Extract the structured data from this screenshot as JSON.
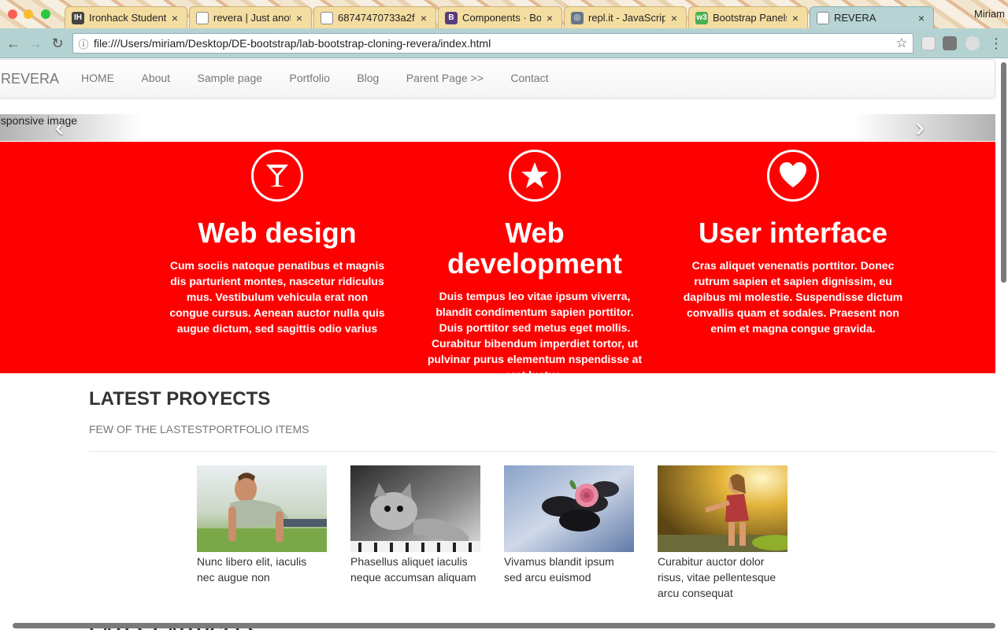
{
  "browser": {
    "tabs": [
      {
        "title": "Ironhack Student |",
        "icon": "ironhack-icon",
        "icon_label": "IH",
        "icon_color": "#444444"
      },
      {
        "title": "revera | Just anoth",
        "icon": "page-icon",
        "icon_label": "",
        "icon_color": "#888888"
      },
      {
        "title": "68747470733a2f",
        "icon": "page-icon",
        "icon_label": "",
        "icon_color": "#888888"
      },
      {
        "title": "Components · Boo",
        "icon": "bootstrap-icon",
        "icon_label": "B",
        "icon_color": "#563d7c"
      },
      {
        "title": "repl.it - JavaScrip",
        "icon": "replit-icon",
        "icon_label": "◎",
        "icon_color": "#667788"
      },
      {
        "title": "Bootstrap Panels",
        "icon": "w3schools-icon",
        "icon_label": "w3",
        "icon_color": "#4caf50"
      },
      {
        "title": "REVERA",
        "icon": "page-icon",
        "icon_label": "",
        "icon_color": "#888888"
      }
    ],
    "profile_name": "Miriam",
    "address": "file:///Users/miriam/Desktop/DE-bootstrap/lab-bootstrap-cloning-revera/index.html"
  },
  "site": {
    "brand": "REVERA",
    "menu": [
      "HOME",
      "About",
      "Sample page",
      "Portfolio",
      "Blog",
      "Parent Page >>",
      "Contact"
    ]
  },
  "carousel": {
    "alt_text": "esponsive image",
    "prev_glyph": "‹",
    "next_glyph": "›"
  },
  "hero": {
    "background": "#ff0000",
    "features": [
      {
        "icon": "cocktail-icon",
        "title": "Web design",
        "text": "Cum sociis natoque penatibus et magnis dis parturient montes, nascetur ridiculus mus. Vestibulum vehicula erat non congue cursus. Aenean auctor nulla quis augue dictum, sed sagittis odio varius"
      },
      {
        "icon": "star-icon",
        "title": "Web development",
        "text": "Duis tempus leo vitae ipsum viverra, blandit condimentum sapien porttitor. Duis porttitor sed metus eget mollis. Curabitur bibendum imperdiet tortor, ut pulvinar purus elementum nspendisse at erat luctus."
      },
      {
        "icon": "heart-icon",
        "title": "User interface",
        "text": "Cras aliquet venenatis porttitor. Donec rutrum sapien et sapien dignissim, eu dapibus mi molestie. Suspendisse dictum convallis quam et sodales. Praesent non enim et magna congue gravida."
      }
    ]
  },
  "projects": {
    "heading": "LATEST PROYECTS",
    "subheading": "FEW OF THE LASTESTPORTFOLIO ITEMS",
    "items": [
      {
        "caption": "Nunc libero elit, iaculis nec augue non",
        "image": "man-pushup-photo"
      },
      {
        "caption": "Phasellus aliquet iaculis neque accumsan aliquam",
        "image": "kitten-photo"
      },
      {
        "caption": "Vivamus blandit ipsum sed arcu euismod",
        "image": "rose-stones-photo"
      },
      {
        "caption": "Curabitur auctor dolor risus, vitae pellentesque arcu consequat",
        "image": "woman-sunlight-photo"
      }
    ]
  },
  "articles": {
    "heading": "LATEST ARTICLES"
  }
}
